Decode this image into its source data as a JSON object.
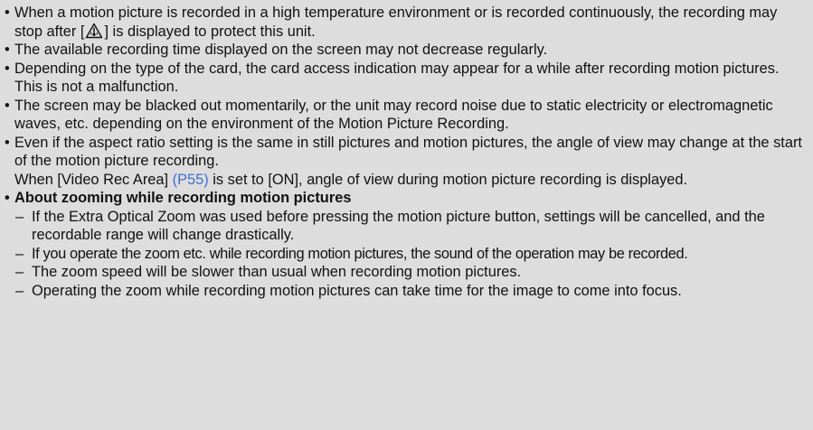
{
  "bullets": [
    {
      "before_icon": "When a motion picture is recorded in a high temperature environment or is recorded continuously, the recording may stop after [",
      "icon": "temperature-warning-icon",
      "after_icon": "] is displayed to protect this unit."
    },
    {
      "text": "The available recording time displayed on the screen may not decrease regularly."
    },
    {
      "text": "Depending on the type of the card, the card access indication may appear for a while after recording motion pictures. This is not a malfunction."
    },
    {
      "text": "The screen may be blacked out momentarily, or the unit may record noise due to static electricity or electromagnetic waves, etc. depending on the environment of the Motion Picture Recording."
    },
    {
      "text": "Even if the aspect ratio setting is the same in still pictures and motion pictures, the angle of view may change at the start of the motion picture recording.",
      "note_before_link": "When [Video Rec Area] ",
      "note_link": "(P55)",
      "note_after_link": " is set to [ON], angle of view during motion picture recording is displayed."
    }
  ],
  "zoom_section": {
    "heading": "About zooming while recording motion pictures",
    "items": [
      "If the Extra Optical Zoom was used before pressing the motion picture button, settings will be cancelled, and the recordable range will change drastically.",
      "If you operate the zoom etc. while recording motion pictures, the sound of the operation may be recorded.",
      "The zoom speed will be slower than usual when recording motion pictures.",
      "Operating the zoom while recording motion pictures can take time for the image to come into focus."
    ]
  },
  "symbols": {
    "bullet": "•",
    "dash": "–"
  }
}
